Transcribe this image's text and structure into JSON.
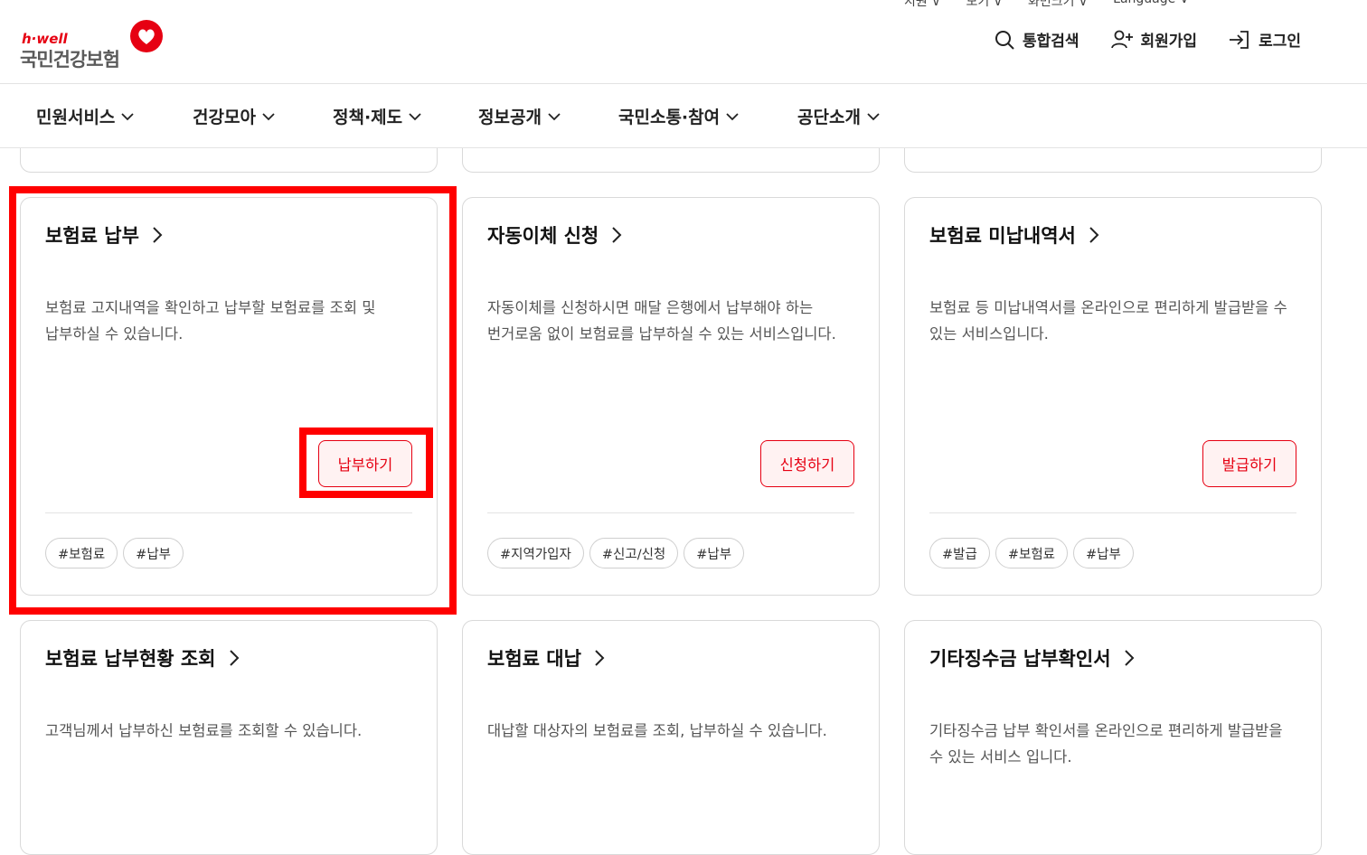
{
  "utility_nav": [
    "지원 ∨",
    "보기 ∨",
    "화면크기 ∨",
    "Language ∨"
  ],
  "logo": {
    "tagline": "h·well",
    "name": "국민건강보험"
  },
  "header_links": {
    "search": "통합검색",
    "join": "회원가입",
    "login": "로그인"
  },
  "gnb": [
    "민원서비스",
    "건강모아",
    "정책·제도",
    "정보공개",
    "국민소통·참여",
    "공단소개"
  ],
  "cards_row1": [
    {
      "title": "보험료 납부",
      "desc": "보험료 고지내역을 확인하고 납부할 보험료를 조회 및 납부하실 수 있습니다.",
      "button": "납부하기",
      "tags": [
        "#보험료",
        "#납부"
      ]
    },
    {
      "title": "자동이체 신청",
      "desc": "자동이체를 신청하시면 매달 은행에서 납부해야 하는 번거로움 없이 보험료를 납부하실 수 있는 서비스입니다.",
      "button": "신청하기",
      "tags": [
        "#지역가입자",
        "#신고/신청",
        "#납부"
      ]
    },
    {
      "title": "보험료 미납내역서",
      "desc": "보험료 등 미납내역서를 온라인으로 편리하게 발급받을 수 있는 서비스입니다.",
      "button": "발급하기",
      "tags": [
        "#발급",
        "#보험료",
        "#납부"
      ]
    }
  ],
  "cards_row2": [
    {
      "title": "보험료 납부현황 조회",
      "desc": "고객님께서 납부하신 보험료를 조회할 수 있습니다."
    },
    {
      "title": "보험료 대납",
      "desc": "대납할 대상자의 보험료를 조회, 납부하실 수 있습니다."
    },
    {
      "title": "기타징수금 납부확인서",
      "desc": "기타징수금 납부 확인서를 온라인으로 편리하게 발급받을 수 있는 서비스 입니다."
    }
  ],
  "colors": {
    "brand_red": "#e60012",
    "highlight": "#ff0000",
    "button_bg": "#fff2f2"
  }
}
